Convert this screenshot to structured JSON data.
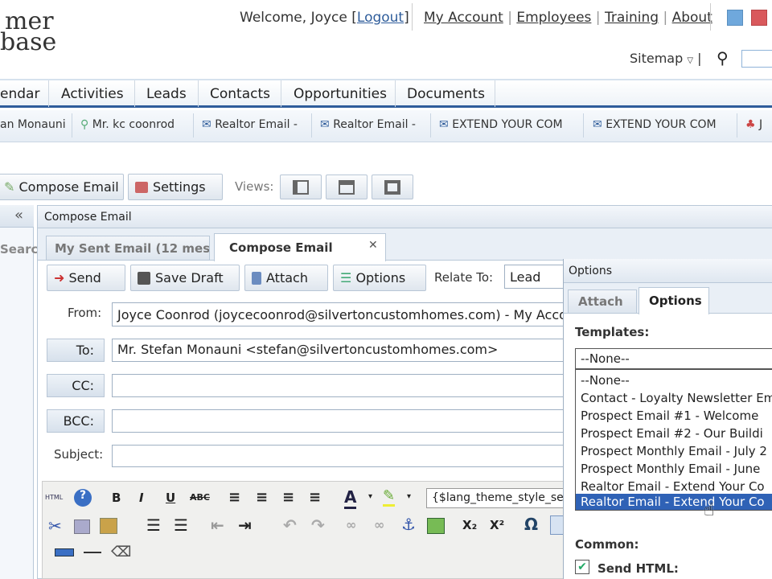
{
  "header": {
    "logo_line1": "mer",
    "logo_line2": "base",
    "welcome": "Welcome, Joyce [",
    "logout": "Logout",
    "welcome_end": "]",
    "links": [
      "My Account",
      "Employees",
      "Training",
      "About"
    ],
    "sitemap": "Sitemap",
    "sitemap_sep": "|"
  },
  "nav": {
    "items": [
      "endar",
      "Activities",
      "Leads",
      "Contacts",
      "Opportunities",
      "Documents"
    ]
  },
  "recent": {
    "items": [
      "an Monauni",
      "Mr. kc coonrod",
      "Realtor Email -",
      "Realtor Email -",
      "EXTEND YOUR COM",
      "EXTEND YOUR COM",
      "J"
    ]
  },
  "toolbar": {
    "compose": "Compose Email",
    "settings": "Settings",
    "views": "Views:"
  },
  "left": {
    "collapse": "«",
    "search": "Searc"
  },
  "panel": {
    "title": "Compose Email",
    "tabs": [
      "My Sent Email (12 mes",
      "Compose Email"
    ]
  },
  "actions": {
    "send": "Send",
    "save_draft": "Save Draft",
    "attach": "Attach",
    "options": "Options",
    "relate_to": "Relate To:",
    "relate_value": "Lead"
  },
  "form": {
    "from_label": "From:",
    "from_value": "Joyce Coonrod (joycecoonrod@silvertoncustomhomes.com) - My Acco",
    "to_label": "To:",
    "to_value": "Mr. Stefan Monauni <stefan@silvertoncustomhomes.com>",
    "cc_label": "CC:",
    "bcc_label": "BCC:",
    "subject_label": "Subject:"
  },
  "editor": {
    "style_select": "{$lang_theme_style_sel",
    "html": "HTML"
  },
  "options_panel": {
    "title": "Options",
    "tabs": [
      "Attach",
      "Options"
    ],
    "templates_label": "Templates:",
    "selected": "--None--",
    "list": [
      "--None--",
      "Contact - Loyalty Newsletter Em",
      "Prospect Email #1 - Welcome",
      "Prospect Email #2 - Our Buildi",
      "Prospect Monthly Email - July 2",
      "Prospect Monthly Email - June",
      "Realtor Email - Extend Your Co",
      "Realtor Email - Extend Your Co"
    ],
    "highlight_index": 7,
    "common_label": "Common:",
    "send_html": "Send HTML:"
  },
  "colors": {
    "accent": "#2f5d9b",
    "highlight": "#2f62b6",
    "border": "#9fb0c3"
  }
}
